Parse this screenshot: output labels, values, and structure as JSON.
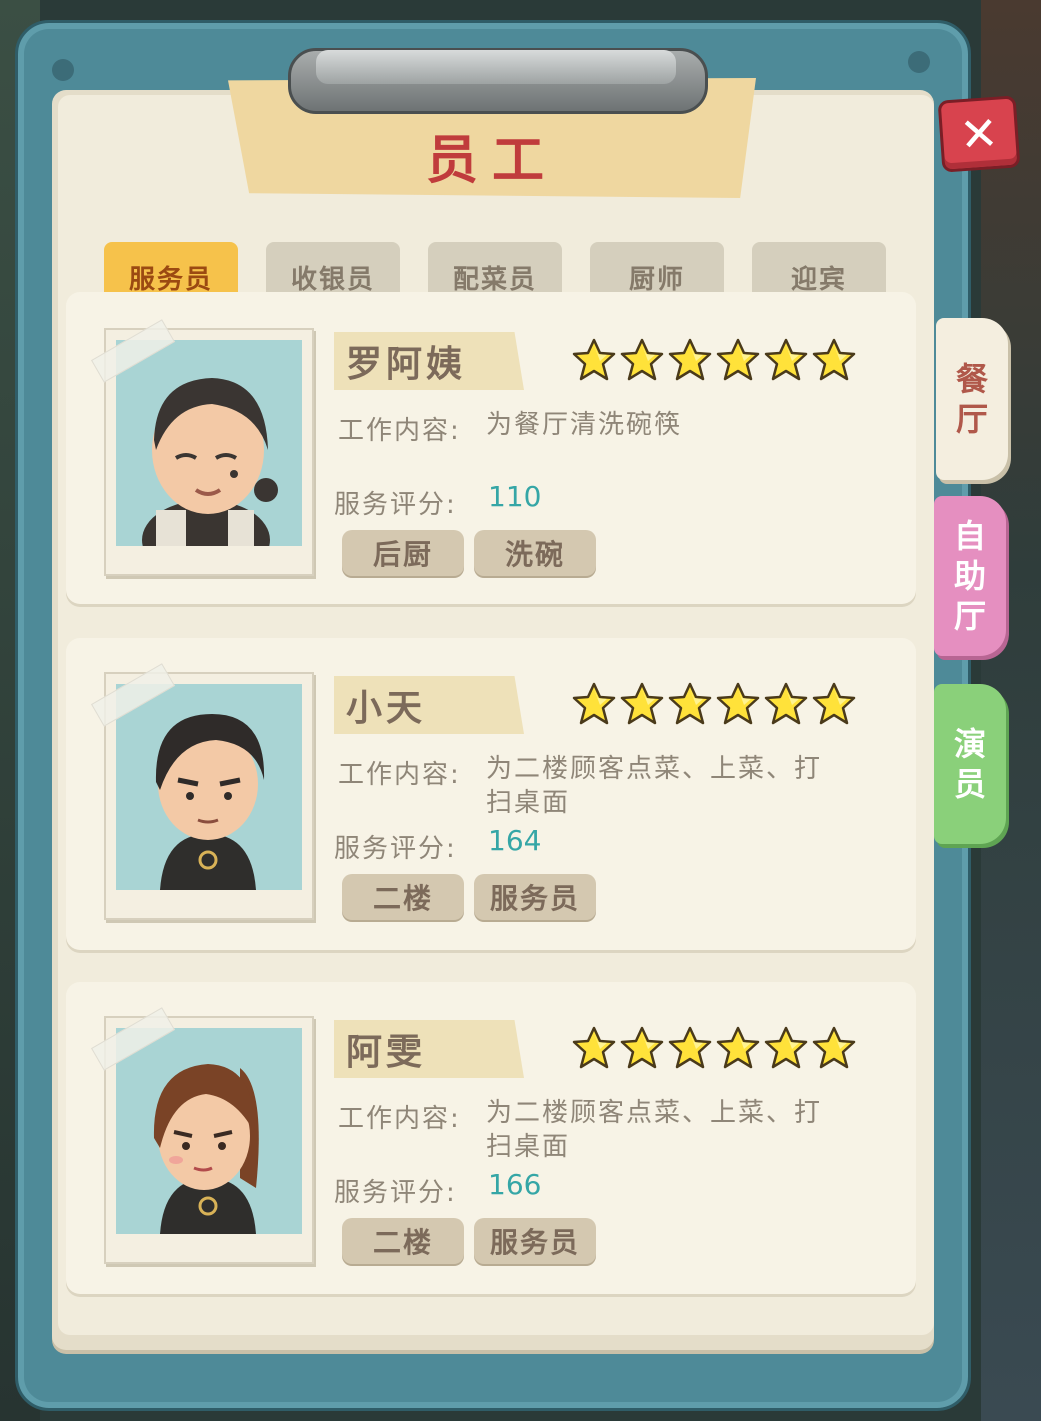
{
  "title": "员工",
  "close_label": "✕",
  "tabs": [
    {
      "label": "服务员",
      "active": true
    },
    {
      "label": "收银员",
      "active": false
    },
    {
      "label": "配菜员",
      "active": false
    },
    {
      "label": "厨师",
      "active": false
    },
    {
      "label": "迎宾",
      "active": false
    }
  ],
  "side_tabs": [
    {
      "label": "餐厅",
      "color": "#f4eedf"
    },
    {
      "label": "自助厅",
      "color": "#e58fc0"
    },
    {
      "label": "演员",
      "color": "#8ad07a"
    }
  ],
  "labels": {
    "work": "工作内容:",
    "score": "服务评分:"
  },
  "staff": [
    {
      "name": "罗阿姨",
      "stars": 6,
      "work": "为餐厅清洗碗筷",
      "score": "110",
      "tags": [
        "后厨",
        "洗碗"
      ]
    },
    {
      "name": "小天",
      "stars": 6,
      "work": "为二楼顾客点菜、上菜、打扫桌面",
      "score": "164",
      "tags": [
        "二楼",
        "服务员"
      ]
    },
    {
      "name": "阿雯",
      "stars": 6,
      "work": "为二楼顾客点菜、上菜、打扫桌面",
      "score": "166",
      "tags": [
        "二楼",
        "服务员"
      ]
    }
  ]
}
